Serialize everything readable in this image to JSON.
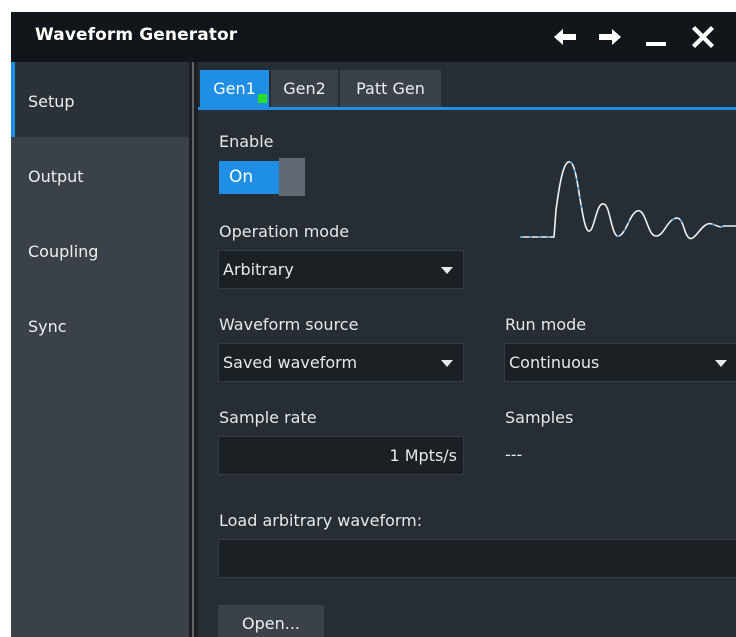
{
  "window": {
    "title": "Waveform Generator",
    "controls": {
      "back_icon": "arrow-left-icon",
      "forward_icon": "arrow-right-icon",
      "minimize_icon": "minimize-icon",
      "close_icon": "close-icon"
    }
  },
  "sidebar": {
    "items": [
      {
        "label": "Setup",
        "active": true
      },
      {
        "label": "Output",
        "active": false
      },
      {
        "label": "Coupling",
        "active": false
      },
      {
        "label": "Sync",
        "active": false
      }
    ]
  },
  "tabs": [
    {
      "label": "Gen1",
      "active": true
    },
    {
      "label": "Gen2",
      "active": false
    },
    {
      "label": "Patt Gen",
      "active": false
    }
  ],
  "enable": {
    "label": "Enable",
    "state": "On"
  },
  "operation_mode": {
    "label": "Operation mode",
    "value": "Arbitrary"
  },
  "waveform_source": {
    "label": "Waveform source",
    "value": "Saved waveform"
  },
  "run_mode": {
    "label": "Run mode",
    "value": "Continuous"
  },
  "sample_rate": {
    "label": "Sample rate",
    "value": "1 Mpts/s"
  },
  "samples": {
    "label": "Samples",
    "value": "---"
  },
  "load_waveform": {
    "label": "Load arbitrary waveform:",
    "value": ""
  },
  "open_button": {
    "label": "Open..."
  },
  "colors": {
    "accent": "#1f8fe6",
    "indicator": "#28e028",
    "background": "#262d33",
    "sidebar": "#3a4148",
    "titlebar": "#11161b"
  }
}
